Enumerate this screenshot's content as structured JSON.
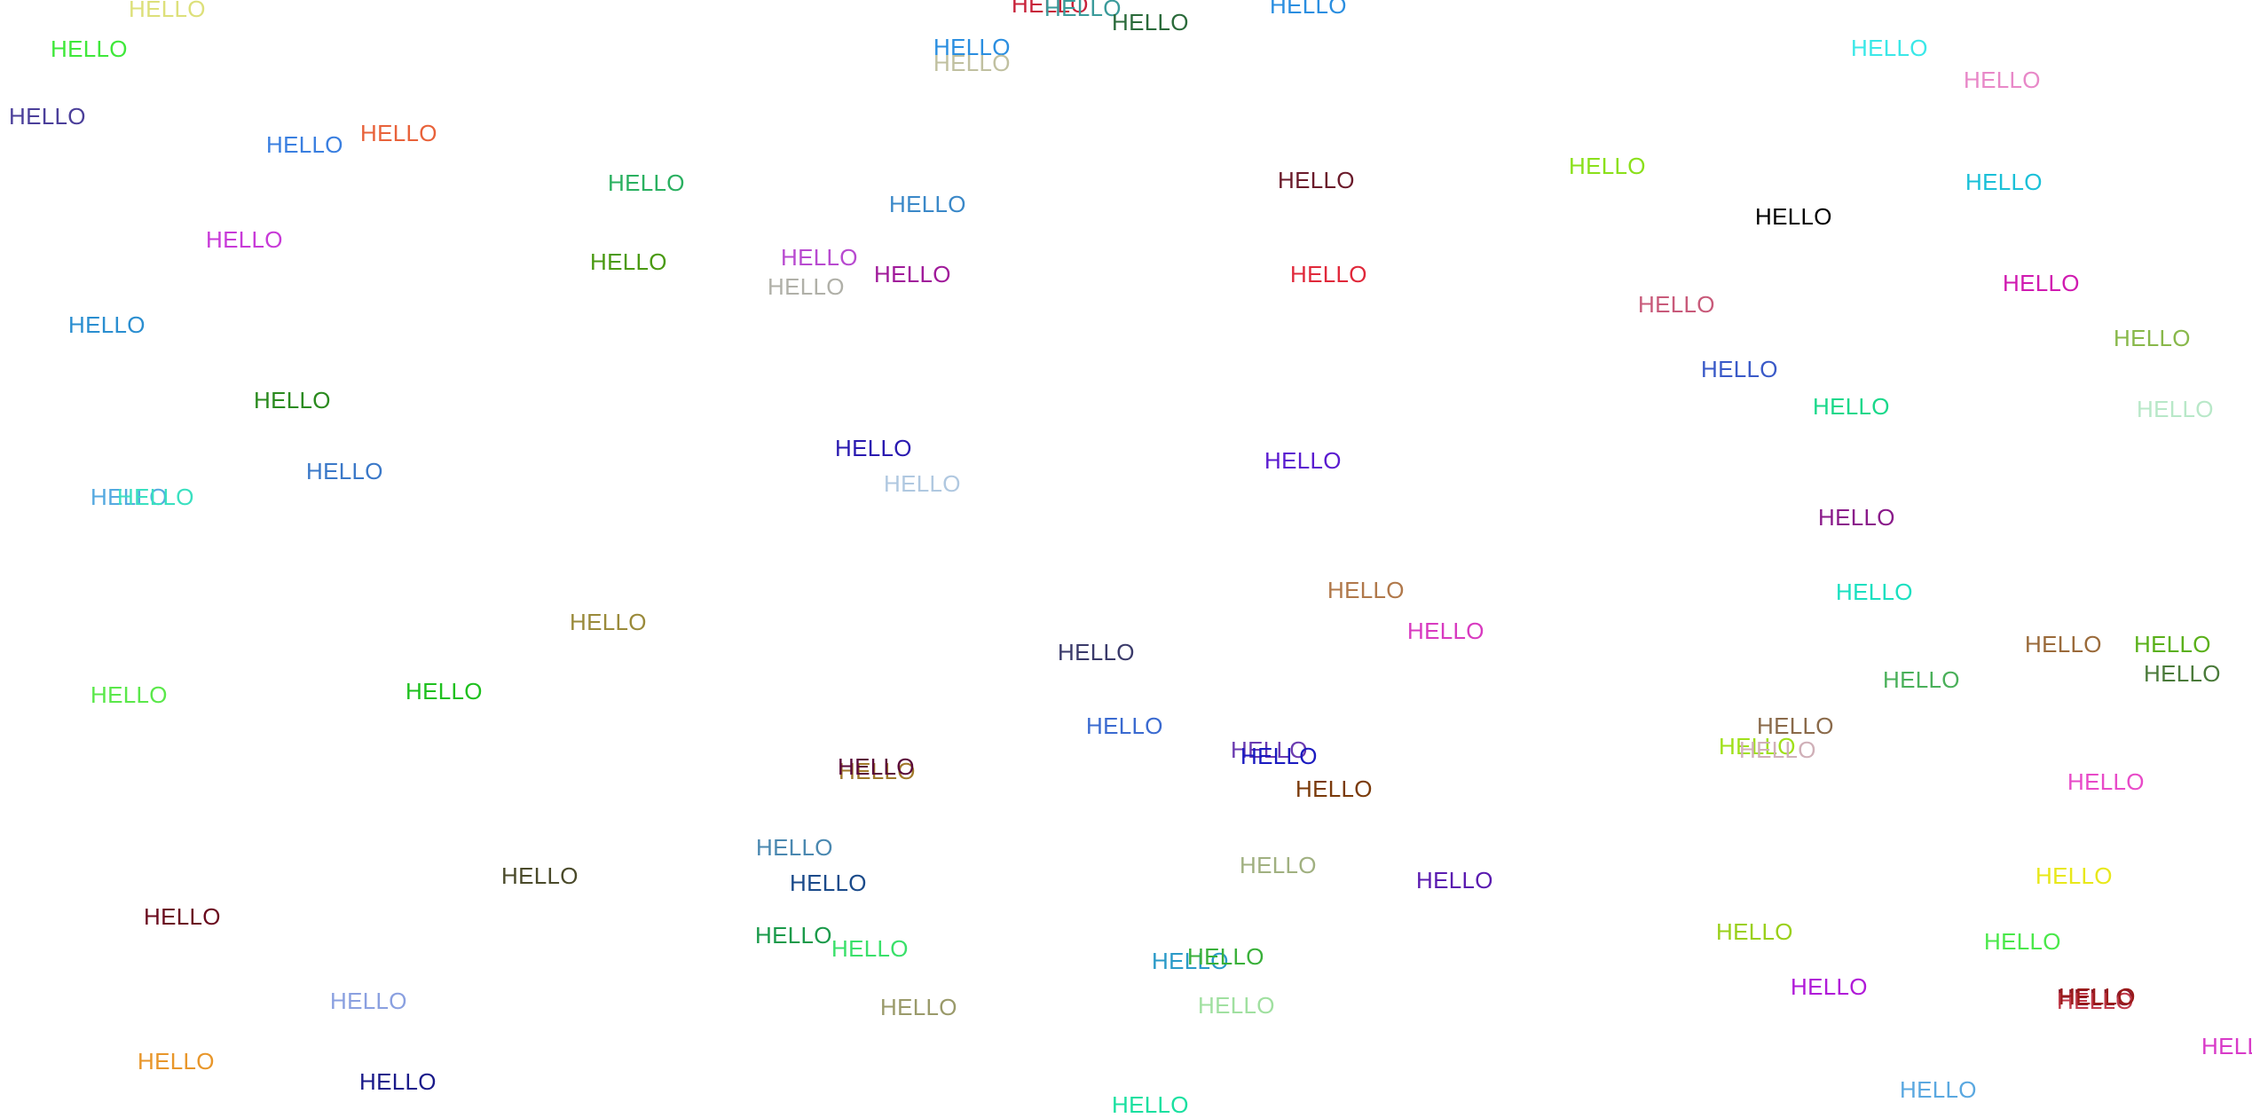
{
  "words": [
    {
      "text": "HELLO",
      "color": "#dde07a"
    },
    {
      "text": "HELLO",
      "color": "#3fe83a"
    },
    {
      "text": "HELLO",
      "color": "#4b3f9a"
    },
    {
      "text": "HELLO",
      "color": "#3a7fe0"
    },
    {
      "text": "HELLO",
      "color": "#e8623a"
    },
    {
      "text": "HELLO",
      "color": "#c83ad8"
    },
    {
      "text": "HELLO",
      "color": "#2a8ed0"
    },
    {
      "text": "HELLO",
      "color": "#2a8a1e"
    },
    {
      "text": "HELLO",
      "color": "#3a78c8"
    },
    {
      "text": "HELLO",
      "color": "#55a9e0"
    },
    {
      "text": "HELLO",
      "color": "#3ae0c0"
    },
    {
      "text": "HELLO",
      "color": "#5ae84a"
    },
    {
      "text": "HELLO",
      "color": "#1ec01e"
    },
    {
      "text": "HELLO",
      "color": "#6a0a1e"
    },
    {
      "text": "HELLO",
      "color": "#8aa0e0"
    },
    {
      "text": "HELLO",
      "color": "#e8962a"
    },
    {
      "text": "HELLO",
      "color": "#1a1a8a"
    },
    {
      "text": "HELLO",
      "color": "#2ab060"
    },
    {
      "text": "HELLO",
      "color": "#4a9a12"
    },
    {
      "text": "HELLO",
      "color": "#9a8a3a"
    },
    {
      "text": "HELLO",
      "color": "#4a4a2a"
    },
    {
      "text": "HELLO",
      "color": "#a0782a"
    },
    {
      "text": "HELLO",
      "color": "#c8223a"
    },
    {
      "text": "HELLO",
      "color": "#3a9a9a"
    },
    {
      "text": "HELLO",
      "color": "#2a6a3a"
    },
    {
      "text": "HELLO",
      "color": "#2a8ee0"
    },
    {
      "text": "HELLO",
      "color": "#2a8ee0"
    },
    {
      "text": "HELLO",
      "color": "#c0c0a0"
    },
    {
      "text": "HELLO",
      "color": "#3a88c8"
    },
    {
      "text": "HELLO",
      "color": "#b84ad0"
    },
    {
      "text": "HELLO",
      "color": "#a01a9a"
    },
    {
      "text": "HELLO",
      "color": "#b0b0a8"
    },
    {
      "text": "HELLO",
      "color": "#2a1ab0"
    },
    {
      "text": "HELLO",
      "color": "#b0c8e0"
    },
    {
      "text": "HELLO",
      "color": "#6a1a2a"
    },
    {
      "text": "HELLO",
      "color": "#e0283a"
    },
    {
      "text": "HELLO",
      "color": "#5a1ad0"
    },
    {
      "text": "HELLO",
      "color": "#b0784a"
    },
    {
      "text": "HELLO",
      "color": "#d83ac0"
    },
    {
      "text": "HELLO",
      "color": "#3a3a6a"
    },
    {
      "text": "HELLO",
      "color": "#3a6ad0"
    },
    {
      "text": "HELLO",
      "color": "#6a3ab0"
    },
    {
      "text": "HELLO",
      "color": "#1a1ac0"
    },
    {
      "text": "HELLO",
      "color": "#7a3a0a"
    },
    {
      "text": "HELLO",
      "color": "#5a0a3a"
    },
    {
      "text": "HELLO",
      "color": "#4a88b0"
    },
    {
      "text": "HELLO",
      "color": "#1a4a8a"
    },
    {
      "text": "HELLO",
      "color": "#1a9a4a"
    },
    {
      "text": "HELLO",
      "color": "#3ae06a"
    },
    {
      "text": "HELLO",
      "color": "#9a9a6a"
    },
    {
      "text": "HELLO",
      "color": "#a0b080"
    },
    {
      "text": "HELLO",
      "color": "#5a1ab0"
    },
    {
      "text": "HELLO",
      "color": "#2a9ac8"
    },
    {
      "text": "HELLO",
      "color": "#3ab03a"
    },
    {
      "text": "HELLO",
      "color": "#a0e0a0"
    },
    {
      "text": "HELLO",
      "color": "#3ae8e8"
    },
    {
      "text": "HELLO",
      "color": "#e888c8"
    },
    {
      "text": "HELLO",
      "color": "#8ae01a"
    },
    {
      "text": "HELLO",
      "color": "#1ac0d8"
    },
    {
      "text": "HELLO",
      "color": "#000000"
    },
    {
      "text": "HELLO",
      "color": "#d01ab0"
    },
    {
      "text": "HELLO",
      "color": "#c85a7a"
    },
    {
      "text": "HELLO",
      "color": "#88b84a"
    },
    {
      "text": "HELLO",
      "color": "#3a5ac8"
    },
    {
      "text": "HELLO",
      "color": "#1ad88a"
    },
    {
      "text": "HELLO",
      "color": "#b8e8c8"
    },
    {
      "text": "HELLO",
      "color": "#8a1a8a"
    },
    {
      "text": "HELLO",
      "color": "#1ae0c0"
    },
    {
      "text": "HELLO",
      "color": "#9a6a3a"
    },
    {
      "text": "HELLO",
      "color": "#5ab01a"
    },
    {
      "text": "HELLO",
      "color": "#4a7a3a"
    },
    {
      "text": "HELLO",
      "color": "#4ab05a"
    },
    {
      "text": "HELLO",
      "color": "#8a6a4a"
    },
    {
      "text": "HELLO",
      "color": "#a0e01a"
    },
    {
      "text": "HELLO",
      "color": "#d0b0b8"
    },
    {
      "text": "HELLO",
      "color": "#e84ac8"
    },
    {
      "text": "HELLO",
      "color": "#e8e81a"
    },
    {
      "text": "HELLO",
      "color": "#9ad01a"
    },
    {
      "text": "HELLO",
      "color": "#4ae84a"
    },
    {
      "text": "HELLO",
      "color": "#b01ad8"
    },
    {
      "text": "HELLO",
      "color": "#8a1a2a"
    },
    {
      "text": "HELLO",
      "color": "#c03a4a"
    },
    {
      "text": "HELLO",
      "color": "#d83ac8"
    },
    {
      "text": "HELLO",
      "color": "#5aa8e0"
    },
    {
      "text": "HELLO",
      "color": "#1ae0a0"
    },
    {
      "text": "HELLO",
      "color": "#9a1a1a"
    }
  ]
}
